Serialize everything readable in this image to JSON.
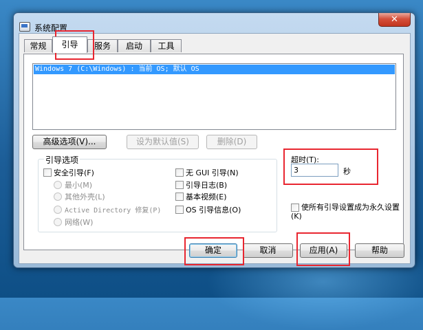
{
  "window": {
    "title": "系统配置",
    "close_label": "✕"
  },
  "tabs": [
    {
      "label": "常规",
      "active": false
    },
    {
      "label": "引导",
      "active": true
    },
    {
      "label": "服务",
      "active": false
    },
    {
      "label": "启动",
      "active": false
    },
    {
      "label": "工具",
      "active": false
    }
  ],
  "os_list": {
    "items": [
      "Windows 7 (C:\\Windows) : 当前 OS; 默认 OS"
    ]
  },
  "os_buttons": {
    "advanced": "高级选项(V)...",
    "set_default": "设为默认值(S)",
    "delete": "删除(D)"
  },
  "boot_options": {
    "title": "引导选项",
    "safe_boot": "安全引导(F)",
    "minimal": "最小(M)",
    "alternate_shell": "其他外壳(L)",
    "ad_repair": "Active Directory 修复(P)",
    "network": "网络(W)",
    "no_gui": "无 GUI 引导(N)",
    "boot_log": "引导日志(B)",
    "base_video": "基本视频(E)",
    "os_boot_info": "OS 引导信息(O)"
  },
  "timeout": {
    "label": "超时(T):",
    "value": "3",
    "unit": "秒"
  },
  "make_permanent": "使所有引导设置成为永久设置(K)",
  "footer": {
    "ok": "确定",
    "cancel": "取消",
    "apply": "应用(A)",
    "help": "帮助"
  },
  "colors": {
    "highlight_box": "#e8252f",
    "selection": "#3399ff"
  }
}
